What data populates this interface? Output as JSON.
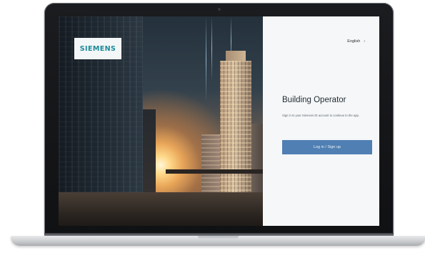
{
  "device": {
    "type": "laptop"
  },
  "brand": {
    "logo_text": "SIEMENS",
    "logo_color": "#1a8a98"
  },
  "login_panel": {
    "language_label": "English",
    "language_icon": "chevron-down-icon",
    "app_title": "Building Operator",
    "subtitle": "Sign in to your Siemens ID account to continue to the app.",
    "login_button_label": "Log in / Sign up",
    "button_color": "#4f7fb3",
    "panel_background": "#f6f7f8"
  }
}
